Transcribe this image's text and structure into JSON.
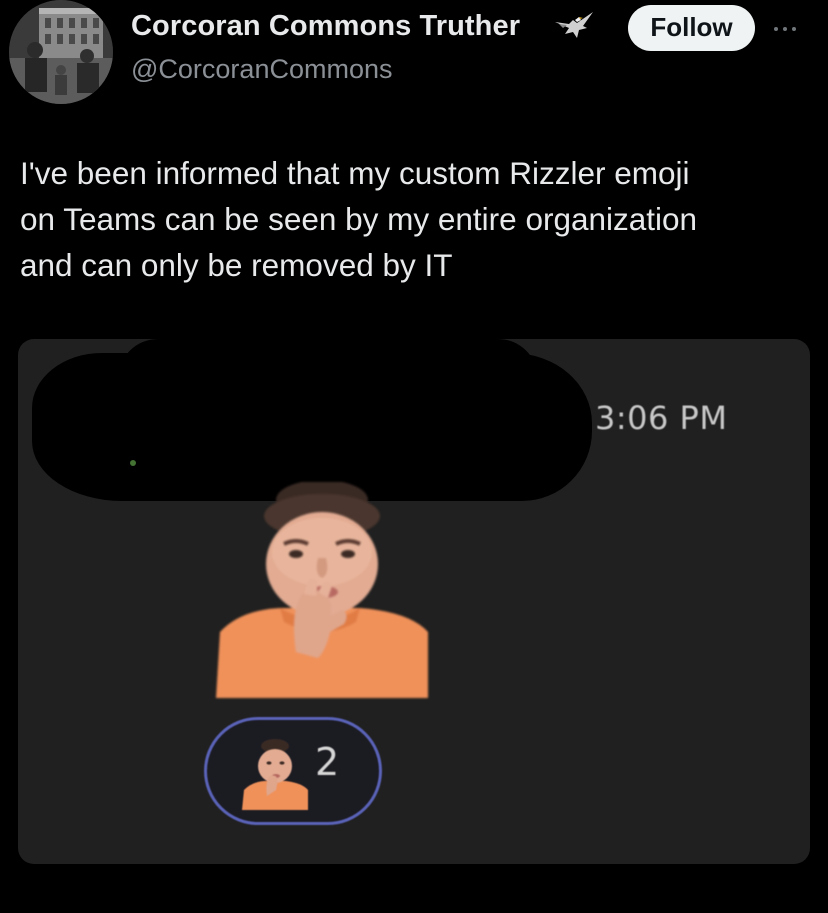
{
  "tweet": {
    "author": {
      "display_name": "Corcoran Commons Truther",
      "handle": "@CorcoranCommons",
      "badge_icon": "eagle-icon",
      "avatar_icon": "profile-photo-icon"
    },
    "follow_label": "Follow",
    "more_icon": "more-options-icon",
    "text_lines": [
      "I've been informed that my custom Rizzler emoji",
      "on Teams can be seen by my entire organization",
      "and can only be removed by IT"
    ]
  },
  "media": {
    "message": {
      "timestamp": "3:06 PM",
      "sender_redacted": true,
      "sticker_icon": "rizzler-emoji-icon"
    },
    "reaction": {
      "emoji_icon": "rizzler-emoji-icon",
      "count": "2"
    }
  },
  "colors": {
    "background": "#000000",
    "text_primary": "#e7e9ea",
    "text_secondary": "#8b9096",
    "follow_button_bg": "#eff3f4",
    "card_bg": "#202020",
    "reaction_border": "#5a63b8",
    "sticker_shirt": "#f0915a"
  }
}
